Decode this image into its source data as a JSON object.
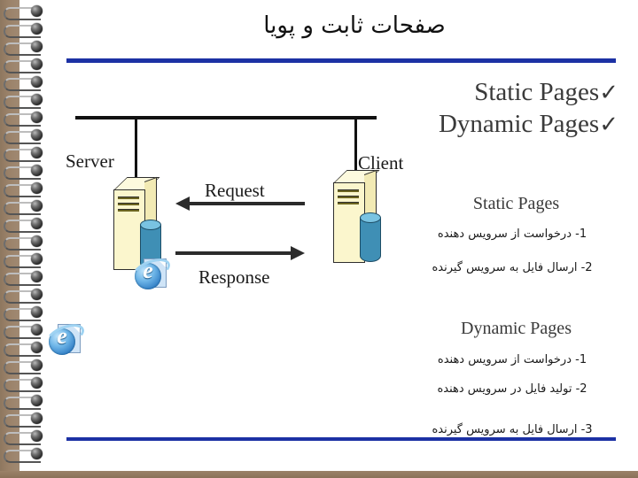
{
  "slide": {
    "title": "صفحات ثابت و پویا",
    "accent_color": "#1c31a4",
    "binding_color": "#9b8269",
    "ring_count": 26
  },
  "checklist": [
    {
      "label": "Static Pages",
      "check": "✓"
    },
    {
      "label": "Dynamic Pages",
      "check": "✓"
    }
  ],
  "diagram": {
    "server_label": "Server",
    "client_label": "Client",
    "request_label": "Request",
    "response_label": "Response",
    "server_icon": "server-tower-icon",
    "client_icon": "server-tower-icon",
    "database_icon": "database-cylinder-icon",
    "browser_icon": "internet-explorer-icon"
  },
  "sections": [
    {
      "title": "Static Pages",
      "steps": [
        "1- درخواست از سرویس دهنده",
        "2- ارسال فایل به سرویس گیرنده"
      ]
    },
    {
      "title": "Dynamic Pages",
      "steps": [
        "1- درخواست از سرویس دهنده",
        "2- تولید فایل در سرویس دهنده",
        "3- ارسال فایل به سرویس گیرنده"
      ]
    }
  ]
}
